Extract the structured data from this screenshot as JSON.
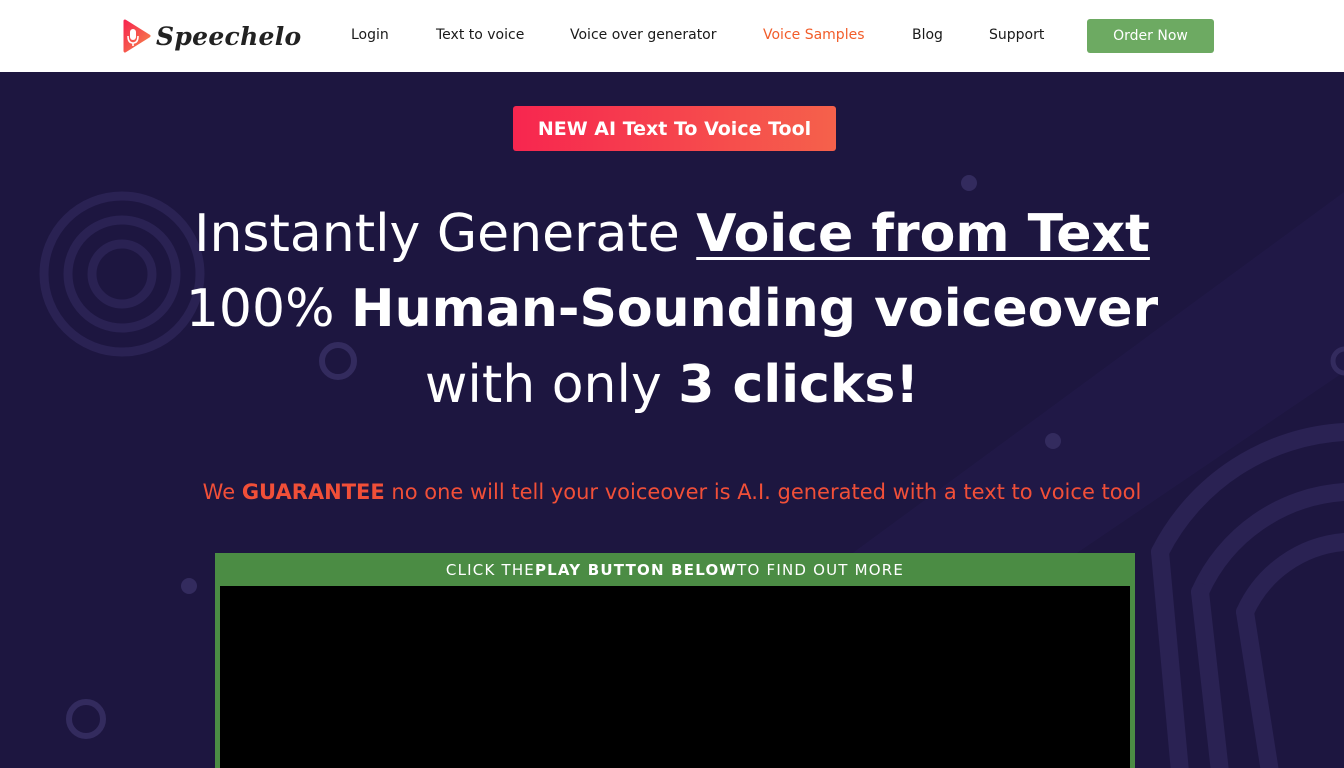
{
  "brand": {
    "name": "Speechelo",
    "accent": "#f25d2a"
  },
  "nav": {
    "items": [
      {
        "label": "Login"
      },
      {
        "label": "Text to voice"
      },
      {
        "label": "Voice over generator"
      },
      {
        "label": "Voice Samples",
        "active": true
      },
      {
        "label": "Blog"
      },
      {
        "label": "Support"
      }
    ],
    "cta_label": "Order Now",
    "cta_color": "#6daa62"
  },
  "hero": {
    "badge": "NEW AI Text To Voice Tool",
    "line1_prefix": "Instantly Generate ",
    "line1_emphasis": "Voice from Text",
    "line2_prefix": "100% ",
    "line2_emphasis": "Human-Sounding voiceover",
    "line3_prefix": "with only ",
    "line3_emphasis": "3 clicks!",
    "guarantee_prefix": "We ",
    "guarantee_emphasis": "GUARANTEE",
    "guarantee_suffix": " no one will tell your voiceover is A.I. generated with a text to voice tool",
    "guarantee_color": "#f14f38",
    "background_color": "#1d1640"
  },
  "video": {
    "caption_prefix": "CLICK THE ",
    "caption_emphasis": "PLAY BUTTON BELOW",
    "caption_suffix": " TO FIND OUT MORE",
    "frame_color": "#4b8c44"
  }
}
